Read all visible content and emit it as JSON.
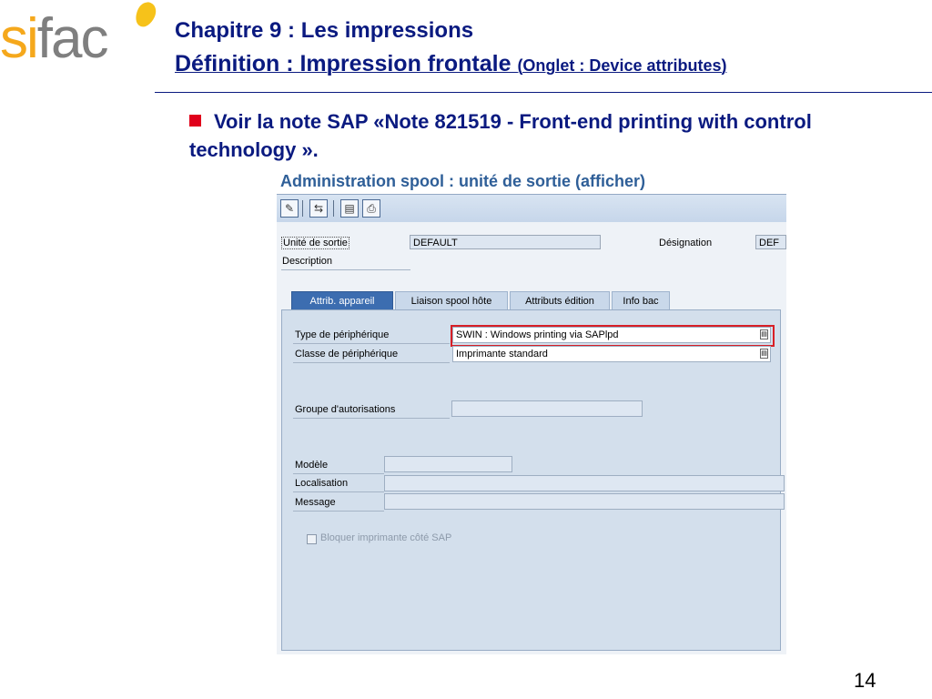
{
  "logo": {
    "text_s": "s",
    "text_i": "i",
    "text_rest": "fac"
  },
  "header": {
    "chapter": "Chapitre 9 : Les impressions",
    "definition": "Définition : Impression frontale",
    "onglet": "(Onglet : Device attributes)"
  },
  "bullet": {
    "text": "Voir la note SAP «Note 821519 - Front-end printing with control technology »."
  },
  "sap": {
    "title": "Administration spool : unité de sortie (afficher)",
    "toolbar": {
      "edit_icon": "pencil-icon",
      "other_icon": "switch-icon",
      "info_icon": "document-icon",
      "print_icon": "print-icon"
    },
    "fields": {
      "output_device_label": "Unité de sortie",
      "output_device_value": "DEFAULT",
      "designation_label": "Désignation",
      "designation_value": "DEF",
      "description_label": "Description"
    },
    "tabs": [
      {
        "label": "Attrib. appareil",
        "active": true
      },
      {
        "label": "Liaison spool hôte",
        "active": false
      },
      {
        "label": "Attributs édition",
        "active": false
      },
      {
        "label": "Info bac",
        "active": false
      }
    ],
    "panel": {
      "device_type_label": "Type de périphérique",
      "device_type_value": "SWIN    : Windows printing via SAPlpd",
      "device_class_label": "Classe de périphérique",
      "device_class_value": "Imprimante standard",
      "auth_group_label": "Groupe d'autorisations",
      "model_label": "Modèle",
      "location_label": "Localisation",
      "message_label": "Message",
      "lock_checkbox_label": "Bloquer imprimante côté SAP"
    },
    "colors": {
      "highlight": "#d81f26",
      "active_tab": "#3c6db0",
      "title": "#2f5f98"
    }
  },
  "page_number": "14"
}
